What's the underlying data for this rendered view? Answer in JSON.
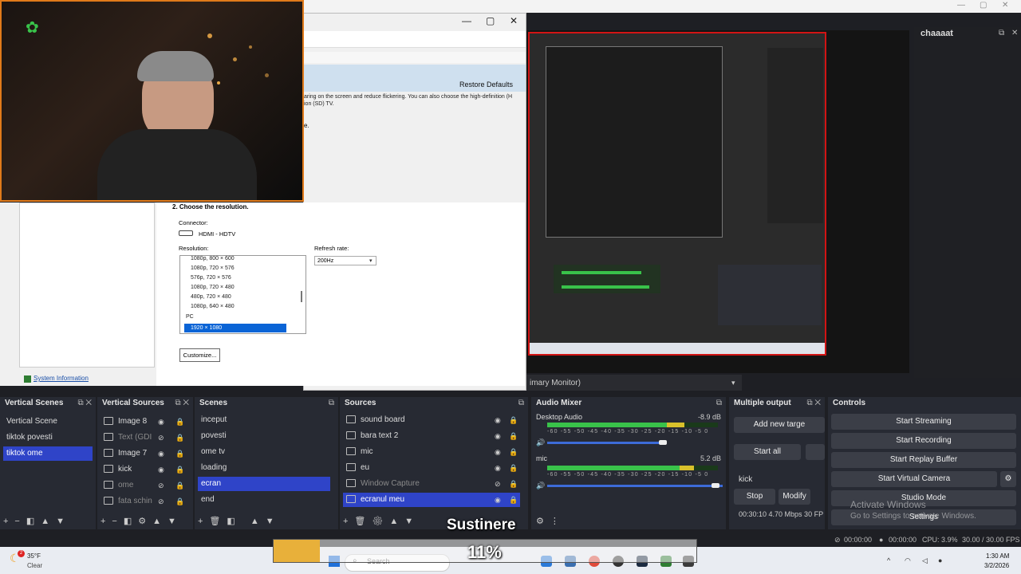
{
  "dialog": {
    "restore_defaults": "Restore Defaults",
    "description": "aring on the screen and reduce flickering. You can also choose the high-definition (H  ion (SD) TV.",
    "section2": "2. Choose the resolution.",
    "connector_label": "Connector:",
    "connector_value": "HDMI - HDTV",
    "resolution_label": "Resolution:",
    "refresh_label": "Refresh rate:",
    "refresh_value": "200Hz",
    "resolutions": [
      "1080p, 800 × 600",
      "1080p, 720 × 576",
      "576p, 720 × 576",
      "1080p, 720 × 480",
      "480p, 720 × 480",
      "1080p, 640 × 480"
    ],
    "pc_group": "PC",
    "selected_resolution": "1920 × 1080",
    "customize": "Customize...",
    "system_info": "System Information"
  },
  "obs": {
    "chat_title": "chaaaat",
    "monitor_label": "imary Monitor)",
    "vertical_scenes": {
      "title": "Vertical Scenes",
      "items": [
        "Vertical Scene",
        "tiktok povesti",
        "tiktok ome"
      ],
      "selected": 2
    },
    "vertical_sources": {
      "title": "Vertical Sources",
      "items": [
        "Image 8",
        "Text (GDI",
        "Image 7",
        "kick",
        "ome",
        "fata schin"
      ]
    },
    "scenes": {
      "title": "Scenes",
      "items": [
        "inceput",
        "povesti",
        "ome tv",
        "loading",
        "ecran",
        "end"
      ],
      "selected": 4
    },
    "sources": {
      "title": "Sources",
      "items": [
        "sound board",
        "bara text 2",
        "mic",
        "eu",
        "Window Capture",
        "ecranul meu"
      ],
      "selected": 5
    },
    "audio_mixer": {
      "title": "Audio Mixer",
      "scale": "-60 -55 -50 -45 -40 -35 -30 -25 -20 -15 -10 -5 0",
      "channels": [
        {
          "name": "Desktop Audio",
          "db": "-8.9 dB"
        },
        {
          "name": "mic",
          "db": "5.2 dB"
        }
      ]
    },
    "multiple_output": {
      "title": "Multiple output",
      "add_target": "Add new targe",
      "start_all": "Start all",
      "target_name": "kick",
      "stop": "Stop",
      "modify": "Modify",
      "stats": "00:30:10  4.70 Mbps  30 FP"
    },
    "controls": {
      "title": "Controls",
      "buttons": [
        "Start Streaming",
        "Start Recording",
        "Start Replay Buffer",
        "Start Virtual Camera",
        "Studio Mode",
        "Settings"
      ]
    },
    "status": {
      "time1": "00:00:00",
      "time2": "00:00:00",
      "cpu": "CPU: 3.9%",
      "fps": "30.00 / 30.00 FPS"
    }
  },
  "overlay": {
    "sustinere": "Sustinere",
    "percent": "11%",
    "progress_fraction": 0.11,
    "activate_title": "Activate Windows",
    "activate_sub": "Go to Settings to activate Windows."
  },
  "taskbar": {
    "weather_temp": "35°F",
    "weather_cond": "Clear",
    "search": "Search",
    "time": "1:30 AM",
    "date": "3/2/2026"
  }
}
